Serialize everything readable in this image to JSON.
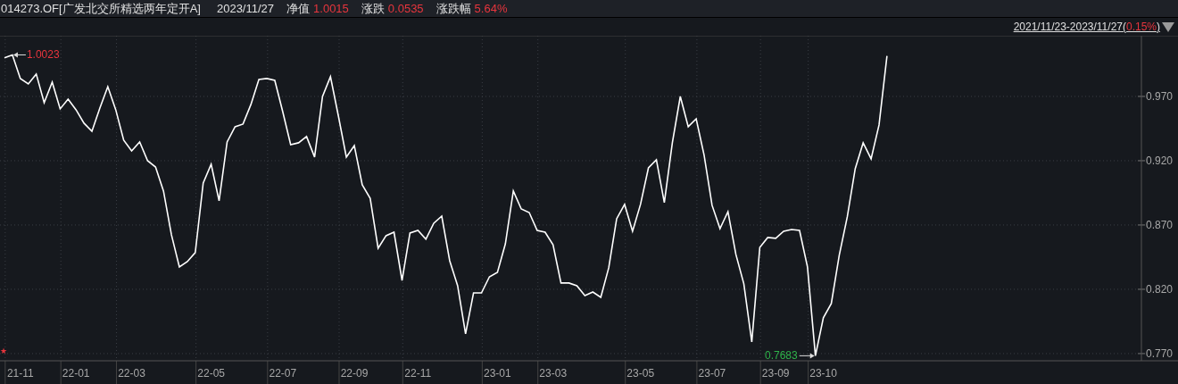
{
  "header": {
    "title": "014273.OF[广发北交所精选两年定开A]",
    "date": "2023/11/27",
    "stats": [
      {
        "label": "净值",
        "value": "1.0015"
      },
      {
        "label": "涨跌",
        "value": "0.0535"
      },
      {
        "label": "涨跌幅",
        "value": "5.64%"
      }
    ]
  },
  "range": {
    "text": "2021/11/23-2023/11/27(",
    "change": "0.15%",
    "close": ")"
  },
  "marker": "★",
  "chart_data": {
    "type": "line",
    "categories": [
      null,
      null,
      "21-11",
      null,
      null,
      null,
      null,
      null,
      null,
      "22-01",
      null,
      null,
      null,
      null,
      null,
      null,
      "22-03",
      null,
      null,
      null,
      null,
      null,
      null,
      null,
      null,
      null,
      "22-05",
      null,
      null,
      null,
      null,
      null,
      null,
      null,
      null,
      "22-07",
      null,
      null,
      null,
      null,
      null,
      null,
      null,
      null,
      "22-09",
      null,
      null,
      null,
      null,
      null,
      null,
      null,
      "22-11",
      null,
      null,
      null,
      null,
      null,
      null,
      null,
      null,
      null,
      "23-01",
      null,
      null,
      null,
      null,
      null,
      null,
      "23-03",
      null,
      null,
      null,
      null,
      null,
      null,
      null,
      null,
      null,
      null,
      "23-05",
      null,
      null,
      null,
      null,
      null,
      null,
      null,
      null,
      "23-07",
      null,
      null,
      null,
      null,
      null,
      null,
      null,
      "23-09",
      null,
      null,
      null,
      null,
      null,
      "23-10",
      null,
      null,
      null,
      null,
      null,
      null,
      null,
      null
    ],
    "grid": true,
    "series": [
      {
        "color": "#ffffff",
        "values": [
          1.0,
          1.0023,
          0.9839,
          0.9797,
          0.9874,
          0.9651,
          0.9811,
          0.9603,
          0.9679,
          0.9596,
          0.9492,
          0.9429,
          0.961,
          0.9776,
          0.9596,
          0.936,
          0.9276,
          0.9346,
          0.92,
          0.9151,
          0.8964,
          0.8624,
          0.8374,
          0.8415,
          0.8485,
          0.9026,
          0.9172,
          0.8888,
          0.9346,
          0.9464,
          0.9485,
          0.9638,
          0.9832,
          0.9839,
          0.9825,
          0.9582,
          0.9325,
          0.9339,
          0.9388,
          0.9228,
          0.97,
          0.9853,
          0.9547,
          0.9228,
          0.9318,
          0.9013,
          0.8908,
          0.8519,
          0.8617,
          0.8644,
          0.8269,
          0.8638,
          0.8658,
          0.8589,
          0.8714,
          0.8769,
          0.8422,
          0.8228,
          0.7853,
          0.8172,
          0.8172,
          0.8297,
          0.8332,
          0.8554,
          0.8964,
          0.8825,
          0.8797,
          0.8658,
          0.8644,
          0.8547,
          0.8249,
          0.8249,
          0.8228,
          0.8151,
          0.8179,
          0.8138,
          0.8367,
          0.8749,
          0.886,
          0.8651,
          0.886,
          0.9144,
          0.9207,
          0.8874,
          0.9339,
          0.97,
          0.9464,
          0.9526,
          0.9242,
          0.8853,
          0.8672,
          0.8804,
          0.8471,
          0.8242,
          0.779,
          0.8526,
          0.8603,
          0.8596,
          0.8651,
          0.8665,
          0.8658,
          0.8374,
          0.7683,
          0.7978,
          0.8089,
          0.8464,
          0.8763,
          0.9138,
          0.9339,
          0.9214,
          0.9478,
          1.0015
        ]
      }
    ],
    "ylim": [
      0.7644,
      1.0172
    ],
    "yticks": [
      {
        "value": 0.77,
        "label": "0.770"
      },
      {
        "value": 0.82,
        "label": "0.820"
      },
      {
        "value": 0.87,
        "label": "0.870"
      },
      {
        "value": 0.92,
        "label": "0.920"
      },
      {
        "value": 0.97,
        "label": "0.970"
      }
    ],
    "annotations": [
      "1.0023",
      "0.7683"
    ]
  }
}
